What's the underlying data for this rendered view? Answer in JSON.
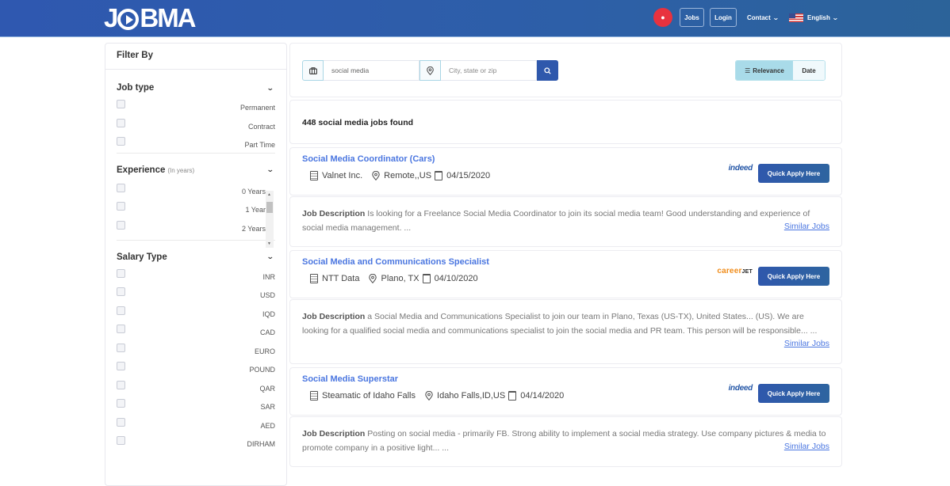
{
  "header": {
    "logo": "JOBMA",
    "notification_icon": "bug-icon",
    "nav": {
      "jobs": "Jobs",
      "login": "Login",
      "contact": "Contact",
      "language": "English"
    }
  },
  "sidebar": {
    "title": "Filter By",
    "job_type": {
      "title": "Job type",
      "options": [
        "Permanent",
        "Contract",
        "Part Time"
      ]
    },
    "experience": {
      "title": "Experience",
      "subtitle": "(In years)",
      "options": [
        "0 Years",
        "1 Year",
        "2 Years"
      ]
    },
    "salary_type": {
      "title": "Salary Type",
      "options": [
        "INR",
        "USD",
        "IQD",
        "CAD",
        "EURO",
        "POUND",
        "QAR",
        "SAR",
        "AED",
        "DIRHAM"
      ]
    }
  },
  "search": {
    "keyword_value": "social media",
    "location_placeholder": "City, state or zip",
    "sort": {
      "relevance": "Relevance",
      "date": "Date",
      "active": "relevance"
    }
  },
  "results": {
    "count_text": "448 social media jobs found"
  },
  "jobs": [
    {
      "title": "Social Media Coordinator (Cars)",
      "company": "Valnet Inc.",
      "location": "Remote,,US",
      "date": "04/15/2020",
      "source": "indeed",
      "apply_label": "Quick Apply Here",
      "desc_label": "Job Description",
      "description": "Is looking for a Freelance Social Media Coordinator to join its social media team! Good understanding and experience of social media management. ...",
      "similar_label": "Similar Jobs"
    },
    {
      "title": "Social Media and Communications Specialist",
      "company": "NTT Data",
      "location": "Plano, TX",
      "date": "04/10/2020",
      "source": "careerjet",
      "apply_label": "Quick Apply Here",
      "desc_label": "Job Description",
      "description": "a Social Media and Communications Specialist to join our team in Plano, Texas (US-TX), United States... (US). We are looking for a qualified social media and communications specialist to join the social media and PR team. This person will be responsible... ...",
      "similar_label": "Similar Jobs"
    },
    {
      "title": "Social Media Superstar",
      "company": "Steamatic of Idaho Falls",
      "location": "Idaho Falls,ID,US",
      "date": "04/14/2020",
      "source": "indeed",
      "apply_label": "Quick Apply Here",
      "desc_label": "Job Description",
      "description": "Posting on social media - primarily FB. Strong ability to implement a social media strategy. Use company pictures & media to promote company in a positive light... ...",
      "similar_label": "Similar Jobs"
    }
  ],
  "sources": {
    "indeed": "indeed",
    "careerjet_a": "career",
    "careerjet_b": "JET"
  },
  "colors": {
    "brand_blue": "#2f58ac",
    "link_blue": "#4a76e0",
    "notification_red": "#e8323f",
    "sort_active": "#a9dbe9"
  }
}
